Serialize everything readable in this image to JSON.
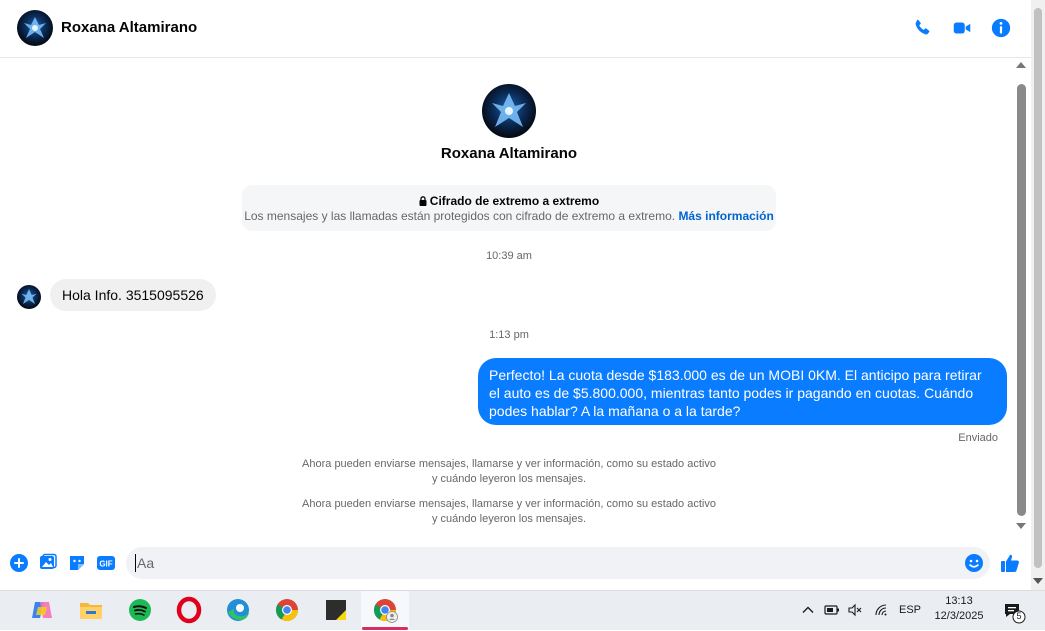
{
  "header": {
    "contact_name": "Roxana Altamirano",
    "icons": [
      "phone-icon",
      "video-camera-icon",
      "info-icon"
    ],
    "accent_color": "#0a7cff"
  },
  "profile": {
    "name": "Roxana Altamirano"
  },
  "encryption_notice": {
    "title": "Cifrado de extremo a extremo",
    "description": "Los mensajes y las llamadas están protegidos con cifrado de extremo a extremo.",
    "link": "Más información"
  },
  "conversation": {
    "timestamp_1": "10:39 am",
    "message_1": "Hola Info. 3515095526",
    "timestamp_2": "1:13 pm",
    "message_2": "Perfecto! La cuota desde $183.000 es de un MOBI 0KM. El anticipo para retirar el auto es de $5.800.000, mientras tanto podes ir pagando en cuotas. Cuándo podes hablar? A la mañana o a la tarde?",
    "message_2_status": "Enviado",
    "system_message_1_line1": "Ahora pueden enviarse mensajes, llamarse y ver información, como su estado activo",
    "system_message_1_line2": "y cuándo leyeron los mensajes.",
    "system_message_2_line1": "Ahora pueden enviarse mensajes, llamarse y ver información, como su estado activo",
    "system_message_2_line2": "y cuándo leyeron los mensajes."
  },
  "composer": {
    "placeholder": "Aa",
    "icons": [
      "plus-icon",
      "image-icon",
      "sticker-icon",
      "gif-icon",
      "emoji-icon",
      "thumbs-up-icon"
    ],
    "gif_label": "GIF"
  },
  "taskbar": {
    "apps": [
      "copilot-icon",
      "file-explorer-icon",
      "spotify-icon",
      "opera-icon",
      "edge-icon",
      "chrome-icon",
      "sticky-notes-icon",
      "chrome-profile-icon"
    ],
    "language": "ESP",
    "time": "13:13",
    "date": "12/3/2025",
    "notification_count": "5"
  }
}
